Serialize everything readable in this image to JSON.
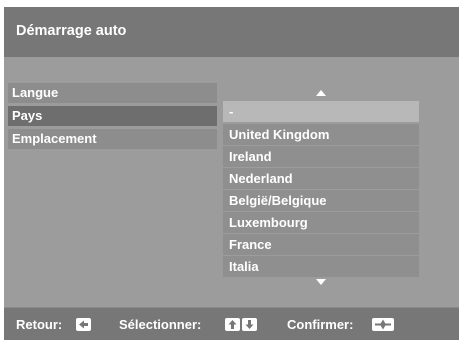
{
  "header": {
    "title": "Démarrage auto"
  },
  "menu": [
    {
      "label": "Langue"
    },
    {
      "label": "Pays"
    },
    {
      "label": "Emplacement"
    }
  ],
  "countries": [
    {
      "label": "-"
    },
    {
      "label": "United Kingdom"
    },
    {
      "label": "Ireland"
    },
    {
      "label": "Nederland"
    },
    {
      "label": "België/Belgique"
    },
    {
      "label": "Luxembourg"
    },
    {
      "label": "France"
    },
    {
      "label": "Italia"
    }
  ],
  "footer": {
    "back_label": "Retour:",
    "select_label": "Sélectionner:",
    "confirm_label": "Confirmer:"
  },
  "icons": {
    "scroll_up": "triangle-up",
    "scroll_down": "triangle-down",
    "back_key": "left-arrow-key",
    "select_keys": "up-down-arrow-keys",
    "confirm_key": "plus-key"
  },
  "colors": {
    "panel": "#9c9c9c",
    "header": "#777777",
    "active_menu": "#6e6e6e",
    "selected_item": "#b8b8b8"
  }
}
